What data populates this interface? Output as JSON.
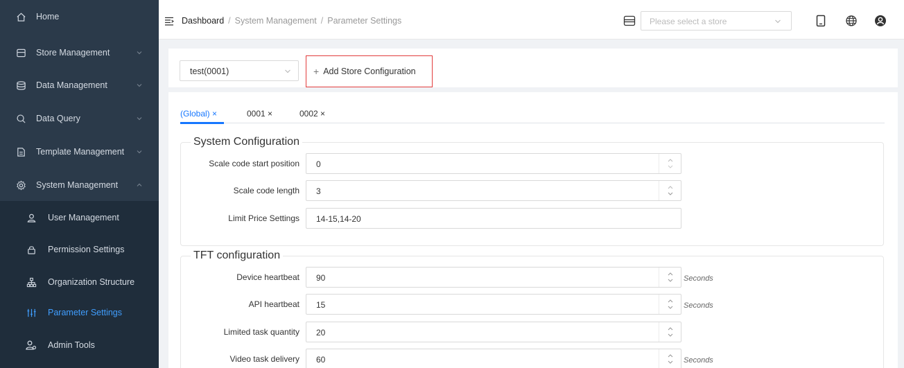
{
  "sidebar": {
    "items": [
      {
        "label": "Home",
        "icon": "home-icon"
      },
      {
        "label": "Store Management",
        "icon": "store-icon"
      },
      {
        "label": "Data Management",
        "icon": "database-icon"
      },
      {
        "label": "Data Query",
        "icon": "search-icon"
      },
      {
        "label": "Template Management",
        "icon": "template-icon"
      },
      {
        "label": "System Management",
        "icon": "gear-icon"
      }
    ],
    "sub_items": [
      {
        "label": "User Management",
        "icon": "user-icon"
      },
      {
        "label": "Permission Settings",
        "icon": "lock-icon"
      },
      {
        "label": "Organization Structure",
        "icon": "org-icon"
      },
      {
        "label": "Parameter Settings",
        "icon": "sliders-icon",
        "active": true
      },
      {
        "label": "Admin Tools",
        "icon": "admin-icon"
      }
    ]
  },
  "header": {
    "breadcrumb": [
      "Dashboard",
      "System Management",
      "Parameter Settings"
    ],
    "breadcrumb_sep": "/",
    "store_select_placeholder": "Please select a store"
  },
  "toolbar": {
    "store_value": "test(0001)",
    "add_label": "Add Store Configuration"
  },
  "tabs": [
    {
      "label": "(Global) ×",
      "active": true
    },
    {
      "label": "0001 ×"
    },
    {
      "label": "0002 ×"
    }
  ],
  "system_config": {
    "title": "System Configuration",
    "fields": [
      {
        "label": "Scale code start position",
        "value": "0",
        "stepper": true
      },
      {
        "label": "Scale code length",
        "value": "3",
        "stepper": true
      },
      {
        "label": "Limit Price Settings",
        "value": "14-15,14-20",
        "stepper": false
      }
    ]
  },
  "tft_config": {
    "title": "TFT configuration",
    "fields": [
      {
        "label": "Device heartbeat",
        "value": "90",
        "unit": "Seconds"
      },
      {
        "label": "API heartbeat",
        "value": "15",
        "unit": "Seconds"
      },
      {
        "label": "Limited task quantity",
        "value": "20",
        "unit": ""
      },
      {
        "label": "Video task delivery",
        "value": "60",
        "unit": "Seconds"
      }
    ]
  },
  "colors": {
    "sidebar": "#2b3a4a",
    "submenu": "#1f2d3b",
    "accent": "#1677ff",
    "highlight": "#e23c3c"
  }
}
